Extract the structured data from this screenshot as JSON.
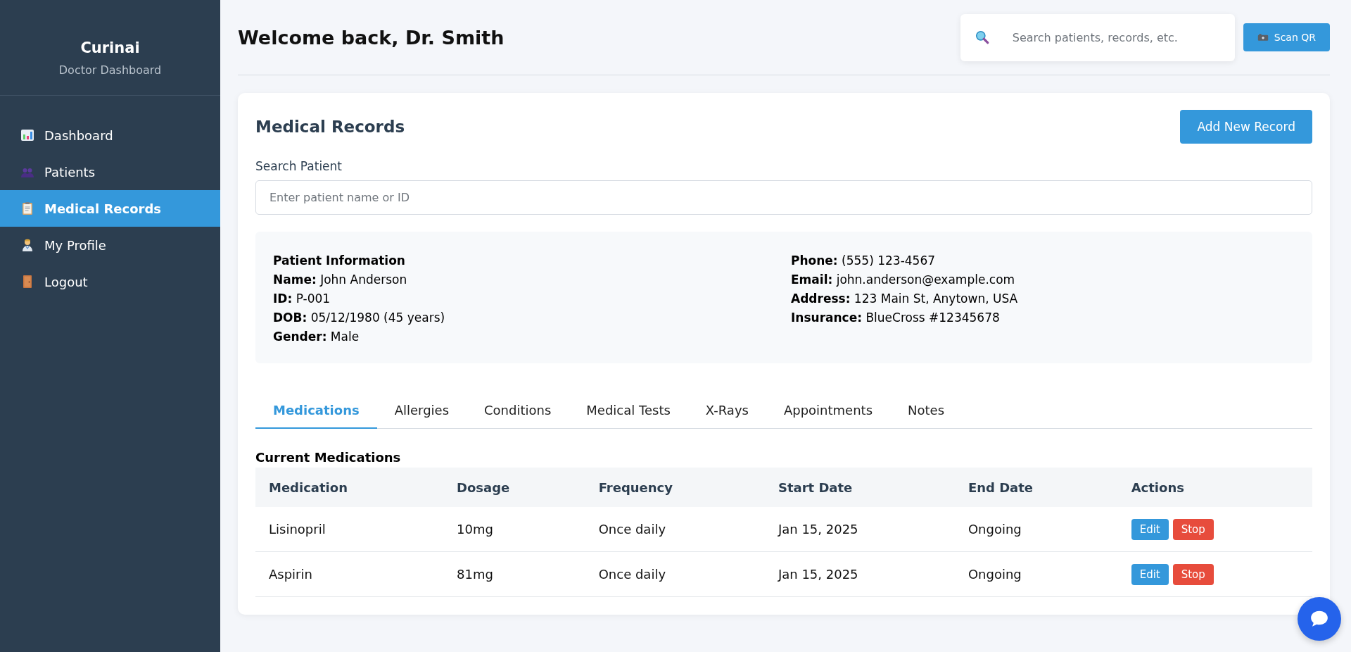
{
  "sidebar": {
    "brand": "Curinai",
    "subtitle": "Doctor Dashboard",
    "items": [
      {
        "label": "Dashboard",
        "kind": "chart",
        "selected": false
      },
      {
        "label": "Patients",
        "kind": "people",
        "selected": false
      },
      {
        "label": "Medical Records",
        "kind": "clipboard",
        "selected": true
      },
      {
        "label": "My Profile",
        "kind": "doctor",
        "selected": false
      },
      {
        "label": "Logout",
        "kind": "door",
        "selected": false
      }
    ]
  },
  "header": {
    "title": "Welcome back, Dr. Smith",
    "search": {
      "placeholder": "Search patients, records, etc."
    },
    "scan_button": "Scan QR"
  },
  "records": {
    "title": "Medical Records",
    "add_button": "Add New Record",
    "search_label": "Search Patient",
    "search_placeholder": "Enter patient name or ID",
    "patient": {
      "heading": "Patient Information",
      "left": [
        "**Name:** John Anderson",
        "**ID:** P-001",
        "**DOB:** 05/12/1980 (45 years)",
        "**Gender:** Male"
      ],
      "right": [
        "**Phone:** (555) 123-4567",
        "**Email:** john.anderson@example.com",
        "**Address:** 123 Main St, Anytown, USA",
        "**Insurance:** BlueCross #12345678"
      ]
    },
    "tabs": [
      {
        "label": "Medications",
        "selected": true
      },
      {
        "label": "Allergies",
        "selected": false
      },
      {
        "label": "Conditions",
        "selected": false
      },
      {
        "label": "Medical Tests",
        "selected": false
      },
      {
        "label": "X-Rays",
        "selected": false
      },
      {
        "label": "Appointments",
        "selected": false
      },
      {
        "label": "Notes",
        "selected": false
      }
    ],
    "section_title": "Current Medications",
    "table": {
      "columns": [
        "Medication",
        "Dosage",
        "Frequency",
        "Start Date",
        "End Date",
        "Actions"
      ],
      "rows": [
        {
          "cells": [
            "Lisinopril",
            "10mg",
            "Once daily",
            "Jan 15, 2025",
            "Ongoing"
          ],
          "actions": [
            "Edit",
            "Stop"
          ]
        },
        {
          "cells": [
            "Aspirin",
            "81mg",
            "Once daily",
            "Jan 15, 2025",
            "Ongoing"
          ],
          "actions": [
            "Edit",
            "Stop"
          ]
        }
      ]
    }
  }
}
